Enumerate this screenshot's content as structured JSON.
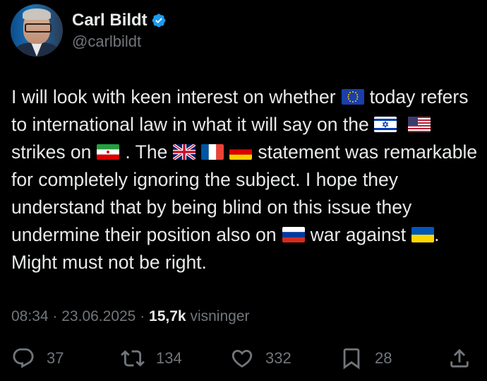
{
  "author": {
    "display_name": "Carl Bildt",
    "handle": "@carlbildt",
    "verified": true,
    "verified_color": "#1d9bf0"
  },
  "tweet": {
    "segments": {
      "s1": "I will look with keen interest on whether",
      "s2": "today refers to international law in what it will say on the",
      "s3": "strikes on",
      "s4": ". The",
      "s5": "statement was remarkable for completely ignoring the subject. I hope they understand that by being blind on this issue they undermine their position also on",
      "s6": "war against",
      "s7": ". Might must not be right."
    },
    "flags": [
      "eu-flag",
      "israel-flag",
      "usa-flag",
      "iran-flag",
      "uk-flag",
      "france-flag",
      "germany-flag",
      "russia-flag",
      "ukraine-flag"
    ]
  },
  "meta": {
    "time": "08:34",
    "date": "23.06.2025",
    "separator": "·",
    "views_count": "15,7k",
    "views_label": "visninger"
  },
  "actions": {
    "replies": "37",
    "reposts": "134",
    "likes": "332",
    "bookmarks": "28"
  },
  "colors": {
    "background": "#000000",
    "text": "#e7e9ea",
    "muted": "#71767b"
  }
}
